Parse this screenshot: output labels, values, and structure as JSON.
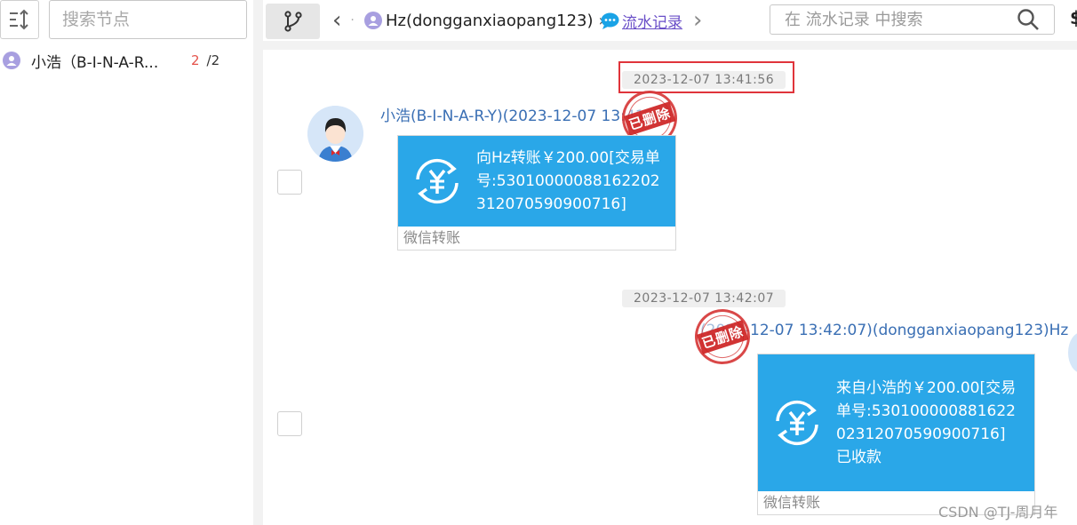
{
  "sidebar": {
    "search_placeholder": "搜索节点",
    "node": {
      "name": "小浩（B-I-N-A-R...",
      "count": "2",
      "total": "/2"
    }
  },
  "breadcrumb": {
    "back": "‹",
    "dot": "·",
    "user": "Hz(dongganxiaopang123)",
    "sep": "›",
    "chat_link": "流水记录",
    "next": "›"
  },
  "top_search_placeholder": "在 流水记录 中搜索",
  "top_right_glyph": "$",
  "messages": [
    {
      "timestamp": "2023-12-07 13:41:56",
      "sender": "小浩(B-I-N-A-R-Y)(2023-12-07 13:41",
      "stamp": "已删除",
      "card_text": "向Hz转账￥200.00[交易单号:53010000088162202312070590900716]",
      "card_footer": "微信转账"
    },
    {
      "timestamp": "2023-12-07 13:42:07",
      "sender": "(2023-12-07 13:42:07)(dongganxiaopang123)Hz",
      "stamp": "已删除",
      "card_text": "来自小浩的￥200.00[交易单号:53010000088162202312070590900716]",
      "card_status": "已收款",
      "card_footer": "微信转账"
    }
  ],
  "watermark": "CSDN @TJ-周月年",
  "colors": {
    "accent": "#2aa7e8",
    "highlight": "#e0343b",
    "link": "#6a4fc8",
    "sender": "#3a6fb4"
  }
}
